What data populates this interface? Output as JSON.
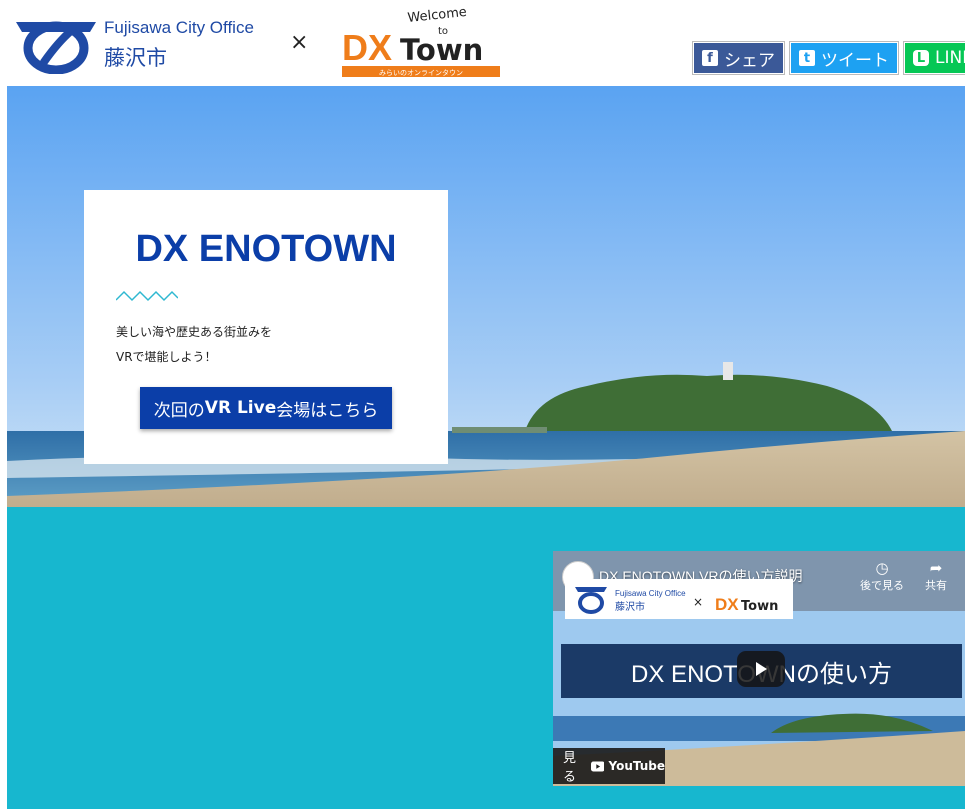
{
  "header": {
    "city_en": "Fujisawa City Office",
    "city_jp": "藤沢市",
    "times": "×",
    "dx_logo": {
      "welcome": "Welcome",
      "to": "to",
      "dx": "DX",
      "town": "Town",
      "tagline": "みらいのオンラインタウン"
    },
    "share": {
      "facebook": "シェア",
      "twitter": "ツイート",
      "line": "LINE"
    }
  },
  "hero": {
    "title": "DX ENOTOWN",
    "desc_line1": "美しい海や歴史ある街並みを",
    "desc_line2": "VRで堪能しよう！",
    "cta_prefix": "次回の",
    "cta_bold": "VR Live",
    "cta_suffix": "会場はこちら"
  },
  "video": {
    "title": "DX ENOTOWN VRの使い方説明",
    "watch_later": "後で見る",
    "share": "共有",
    "inner_city_en": "Fujisawa City Office",
    "inner_city_jp": "藤沢市",
    "inner_times": "×",
    "inner_dx": "DX",
    "inner_town": "Town",
    "banner": "DX ENOTOWNの使い方",
    "watch_on": "見る",
    "youtube": "YouTube"
  },
  "colors": {
    "brand_blue": "#0b3ea8",
    "teal": "#17b7cf",
    "orange": "#ef7d1a",
    "facebook": "#3b5998",
    "twitter": "#1da1f2",
    "line": "#06c755"
  }
}
